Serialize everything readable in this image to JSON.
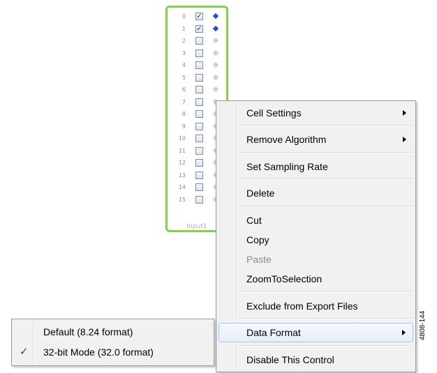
{
  "cell": {
    "label": "Input1",
    "rows": [
      {
        "num": "0",
        "checked": true
      },
      {
        "num": "1",
        "checked": true
      },
      {
        "num": "2",
        "checked": false
      },
      {
        "num": "3",
        "checked": false
      },
      {
        "num": "4",
        "checked": false
      },
      {
        "num": "5",
        "checked": false
      },
      {
        "num": "6",
        "checked": false
      },
      {
        "num": "7",
        "checked": false
      },
      {
        "num": "8",
        "checked": false
      },
      {
        "num": "9",
        "checked": false
      },
      {
        "num": "10",
        "checked": false
      },
      {
        "num": "11",
        "checked": false
      },
      {
        "num": "12",
        "checked": false
      },
      {
        "num": "13",
        "checked": false
      },
      {
        "num": "14",
        "checked": false
      },
      {
        "num": "15",
        "checked": false
      }
    ],
    "colors": {
      "border": "#7fd24a",
      "active_pin": "#1f4fd8",
      "inactive_pin": "#d8c8dc"
    }
  },
  "menu": {
    "cell_settings": "Cell Settings",
    "remove_algorithm": "Remove Algorithm",
    "set_sampling_rate": "Set Sampling Rate",
    "delete": "Delete",
    "cut": "Cut",
    "copy": "Copy",
    "paste": "Paste",
    "zoom_to_selection": "ZoomToSelection",
    "exclude_from_export": "Exclude from Export Files",
    "data_format": "Data Format",
    "disable_control": "Disable This Control"
  },
  "submenu": {
    "default_format": "Default (8.24 format)",
    "bit32_mode": "32-bit Mode (32.0 format)",
    "check_glyph": "✓"
  },
  "figure_code": "4808-144"
}
